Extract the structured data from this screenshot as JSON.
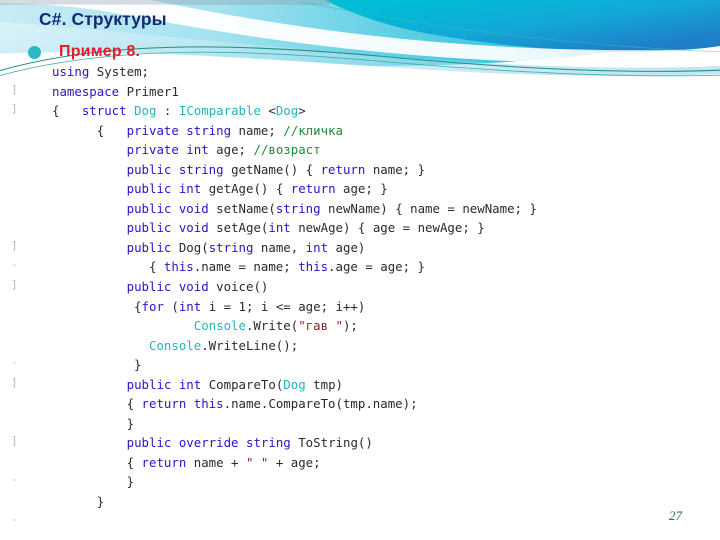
{
  "slide": {
    "title": "C#. Структуры",
    "bullet": {
      "icon": "bullet-dot-icon",
      "text": "Пример 8."
    },
    "page_number": "27"
  },
  "theme": {
    "title_color": "#132a78",
    "bullet_text_color": "#e8192c",
    "bullet_dot_color": "#2bb8c4",
    "banner_cyan": "#00b8d4",
    "banner_blue": "#1b8fd4",
    "banner_teal_line": "#1d8a7a",
    "page_number_color": "#1d6b5e"
  },
  "code": {
    "language": "csharp",
    "colors": {
      "keyword": "#2b14c8",
      "type": "#2ab0bf",
      "comment": "#1f8a3b",
      "string": "#8c2323",
      "plain": "#2b2b2b"
    },
    "lines": [
      {
        "fold": "",
        "indent": 1,
        "tokens": [
          {
            "t": "using",
            "c": "kw"
          },
          {
            "t": " System;",
            "c": "pl"
          }
        ]
      },
      {
        "fold": "]",
        "indent": 0,
        "tokens": [
          {
            "t": "namespace",
            "c": "kw"
          },
          {
            "t": " Primer1",
            "c": "pl"
          }
        ]
      },
      {
        "fold": "]",
        "indent": 0,
        "tokens": [
          {
            "t": "{   ",
            "c": "pl"
          },
          {
            "t": "struct",
            "c": "kw"
          },
          {
            "t": " ",
            "c": "pl"
          },
          {
            "t": "Dog",
            "c": "typ"
          },
          {
            "t": " : ",
            "c": "pl"
          },
          {
            "t": "IComparable",
            "c": "typ"
          },
          {
            "t": " <",
            "c": "pl"
          },
          {
            "t": "Dog",
            "c": "typ"
          },
          {
            "t": ">",
            "c": "pl"
          }
        ]
      },
      {
        "fold": "",
        "indent": 0,
        "tokens": [
          {
            "t": "      {   ",
            "c": "pl"
          },
          {
            "t": "private",
            "c": "kw"
          },
          {
            "t": " ",
            "c": "pl"
          },
          {
            "t": "string",
            "c": "kw"
          },
          {
            "t": " name; ",
            "c": "pl"
          },
          {
            "t": "//кличка",
            "c": "cmt"
          }
        ]
      },
      {
        "fold": "",
        "indent": 0,
        "tokens": [
          {
            "t": "          ",
            "c": "pl"
          },
          {
            "t": "private",
            "c": "kw"
          },
          {
            "t": " ",
            "c": "pl"
          },
          {
            "t": "int",
            "c": "kw"
          },
          {
            "t": " age; ",
            "c": "pl"
          },
          {
            "t": "//возраст",
            "c": "cmt"
          }
        ]
      },
      {
        "fold": "",
        "indent": 0,
        "tokens": [
          {
            "t": "          ",
            "c": "pl"
          },
          {
            "t": "public",
            "c": "kw"
          },
          {
            "t": " ",
            "c": "pl"
          },
          {
            "t": "string",
            "c": "kw"
          },
          {
            "t": " getName() { ",
            "c": "pl"
          },
          {
            "t": "return",
            "c": "kw"
          },
          {
            "t": " name; }",
            "c": "pl"
          }
        ]
      },
      {
        "fold": "",
        "indent": 0,
        "tokens": [
          {
            "t": "          ",
            "c": "pl"
          },
          {
            "t": "public",
            "c": "kw"
          },
          {
            "t": " ",
            "c": "pl"
          },
          {
            "t": "int",
            "c": "kw"
          },
          {
            "t": " getAge() { ",
            "c": "pl"
          },
          {
            "t": "return",
            "c": "kw"
          },
          {
            "t": " age; }",
            "c": "pl"
          }
        ]
      },
      {
        "fold": "",
        "indent": 0,
        "tokens": [
          {
            "t": "          ",
            "c": "pl"
          },
          {
            "t": "public",
            "c": "kw"
          },
          {
            "t": " ",
            "c": "pl"
          },
          {
            "t": "void",
            "c": "kw"
          },
          {
            "t": " setName(",
            "c": "pl"
          },
          {
            "t": "string",
            "c": "kw"
          },
          {
            "t": " newName) { name = newName; }",
            "c": "pl"
          }
        ]
      },
      {
        "fold": "",
        "indent": 0,
        "tokens": [
          {
            "t": "          ",
            "c": "pl"
          },
          {
            "t": "public",
            "c": "kw"
          },
          {
            "t": " ",
            "c": "pl"
          },
          {
            "t": "void",
            "c": "kw"
          },
          {
            "t": " setAge(",
            "c": "pl"
          },
          {
            "t": "int",
            "c": "kw"
          },
          {
            "t": " newAge) { age = newAge; }",
            "c": "pl"
          }
        ]
      },
      {
        "fold": "]",
        "indent": 0,
        "tokens": [
          {
            "t": "          ",
            "c": "pl"
          },
          {
            "t": "public",
            "c": "kw"
          },
          {
            "t": " Dog(",
            "c": "pl"
          },
          {
            "t": "string",
            "c": "kw"
          },
          {
            "t": " name, ",
            "c": "pl"
          },
          {
            "t": "int",
            "c": "kw"
          },
          {
            "t": " age)",
            "c": "pl"
          }
        ]
      },
      {
        "fold": "-",
        "indent": 0,
        "tokens": [
          {
            "t": "             { ",
            "c": "pl"
          },
          {
            "t": "this",
            "c": "kw"
          },
          {
            "t": ".name = name; ",
            "c": "pl"
          },
          {
            "t": "this",
            "c": "kw"
          },
          {
            "t": ".age = age; }",
            "c": "pl"
          }
        ]
      },
      {
        "fold": "]",
        "indent": 0,
        "tokens": [
          {
            "t": "          ",
            "c": "pl"
          },
          {
            "t": "public",
            "c": "kw"
          },
          {
            "t": " ",
            "c": "pl"
          },
          {
            "t": "void",
            "c": "kw"
          },
          {
            "t": " voice()",
            "c": "pl"
          }
        ]
      },
      {
        "fold": "",
        "indent": 0,
        "tokens": [
          {
            "t": "           {",
            "c": "pl"
          },
          {
            "t": "for",
            "c": "kw"
          },
          {
            "t": " (",
            "c": "pl"
          },
          {
            "t": "int",
            "c": "kw"
          },
          {
            "t": " i = 1; i <= age; i++)",
            "c": "pl"
          }
        ]
      },
      {
        "fold": "",
        "indent": 0,
        "tokens": [
          {
            "t": "                   ",
            "c": "pl"
          },
          {
            "t": "Console",
            "c": "typ"
          },
          {
            "t": ".Write(",
            "c": "pl"
          },
          {
            "t": "\"гав \"",
            "c": "str"
          },
          {
            "t": ");",
            "c": "pl"
          }
        ]
      },
      {
        "fold": "",
        "indent": 0,
        "tokens": [
          {
            "t": "             ",
            "c": "pl"
          },
          {
            "t": "Console",
            "c": "typ"
          },
          {
            "t": ".WriteLine();",
            "c": "pl"
          }
        ]
      },
      {
        "fold": "-",
        "indent": 0,
        "tokens": [
          {
            "t": "           }",
            "c": "pl"
          }
        ]
      },
      {
        "fold": "]",
        "indent": 0,
        "tokens": [
          {
            "t": "          ",
            "c": "pl"
          },
          {
            "t": "public",
            "c": "kw"
          },
          {
            "t": " ",
            "c": "pl"
          },
          {
            "t": "int",
            "c": "kw"
          },
          {
            "t": " CompareTo(",
            "c": "pl"
          },
          {
            "t": "Dog",
            "c": "typ"
          },
          {
            "t": " tmp)",
            "c": "pl"
          }
        ]
      },
      {
        "fold": "",
        "indent": 0,
        "tokens": [
          {
            "t": "          { ",
            "c": "pl"
          },
          {
            "t": "return",
            "c": "kw"
          },
          {
            "t": " ",
            "c": "pl"
          },
          {
            "t": "this",
            "c": "kw"
          },
          {
            "t": ".name.CompareTo(tmp.name);",
            "c": "pl"
          }
        ]
      },
      {
        "fold": "",
        "indent": 0,
        "tokens": [
          {
            "t": "          }",
            "c": "pl"
          }
        ]
      },
      {
        "fold": "]",
        "indent": 0,
        "tokens": [
          {
            "t": "          ",
            "c": "pl"
          },
          {
            "t": "public",
            "c": "kw"
          },
          {
            "t": " ",
            "c": "pl"
          },
          {
            "t": "override",
            "c": "kw"
          },
          {
            "t": " ",
            "c": "pl"
          },
          {
            "t": "string",
            "c": "kw"
          },
          {
            "t": " ToString()",
            "c": "pl"
          }
        ]
      },
      {
        "fold": "",
        "indent": 0,
        "tokens": [
          {
            "t": "          { ",
            "c": "pl"
          },
          {
            "t": "return",
            "c": "kw"
          },
          {
            "t": " name + ",
            "c": "pl"
          },
          {
            "t": "\" \"",
            "c": "str"
          },
          {
            "t": " + age;",
            "c": "pl"
          }
        ]
      },
      {
        "fold": "-",
        "indent": 0,
        "tokens": [
          {
            "t": "          }",
            "c": "pl"
          }
        ]
      },
      {
        "fold": "",
        "indent": 0,
        "tokens": [
          {
            "t": "      }",
            "c": "pl"
          }
        ]
      },
      {
        "fold": "-",
        "indent": 0,
        "tokens": [
          {
            "t": "",
            "c": "pl"
          }
        ]
      }
    ]
  }
}
